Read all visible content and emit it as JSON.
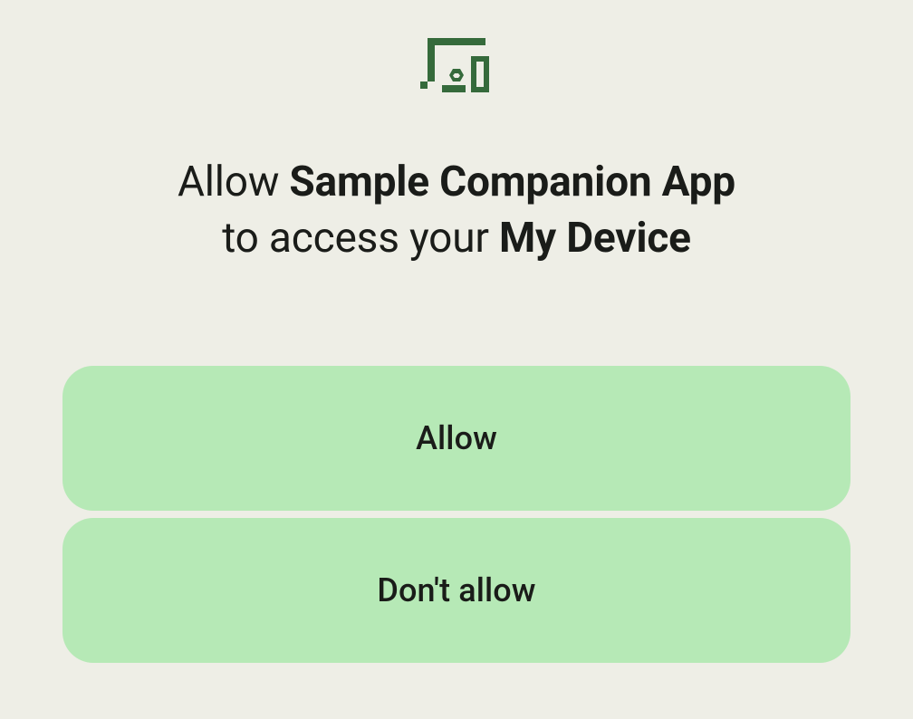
{
  "icon": "devices-icon",
  "iconColor": "#356a3b",
  "heading": {
    "prefix": "Allow ",
    "appName": "Sample Companion App",
    "middle": " to access your ",
    "deviceName": "My Device"
  },
  "buttons": {
    "allow": "Allow",
    "deny": "Don't allow"
  },
  "colors": {
    "background": "#eeeee6",
    "buttonBackground": "#b6e9b6",
    "text": "#1a1c19"
  }
}
